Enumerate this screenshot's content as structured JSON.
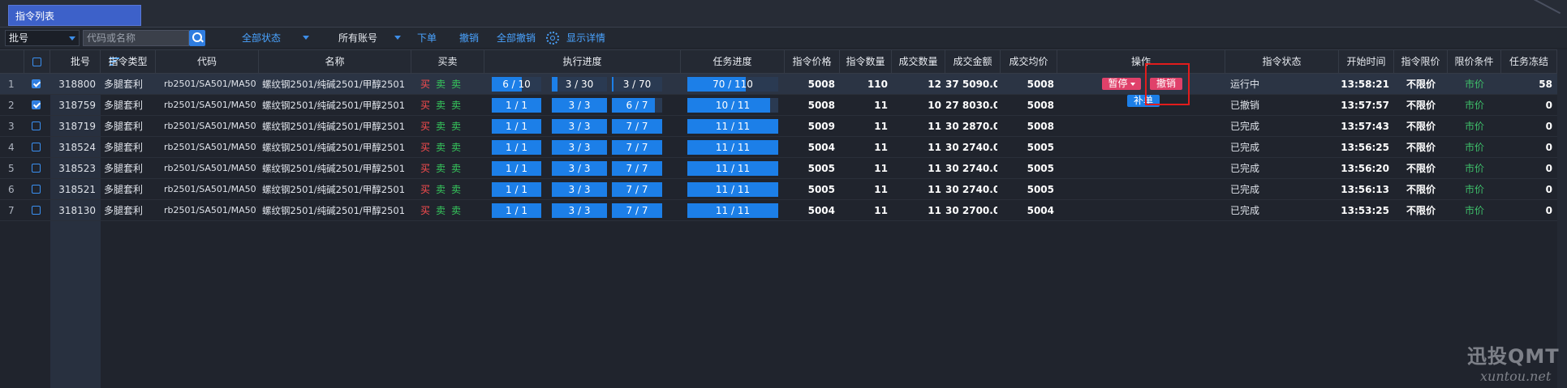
{
  "tab": {
    "label": "指令列表"
  },
  "toolbar": {
    "field_select": "批号",
    "search_placeholder": "代码或名称",
    "status_filter": "全部状态",
    "account_filter": "所有账号",
    "order_button": "下单",
    "cancel_button": "撤销",
    "cancel_all_button": "全部撤销",
    "show_details": "显示详情"
  },
  "columns": [
    "批号",
    "指令类型",
    "代码",
    "名称",
    "买卖",
    "执行进度",
    "任务进度",
    "指令价格",
    "指令数量",
    "成交数量",
    "成交金额",
    "成交均价",
    "操作",
    "指令状态",
    "开始时间",
    "指令限价",
    "限价条件",
    "任务冻结"
  ],
  "colors": {
    "accent": "#2f7de0",
    "buy": "#ff4d4f",
    "sell": "#36c95c",
    "action": "#e0416a",
    "highlight_box": "#e21c1c"
  },
  "rows": [
    {
      "idx": "1",
      "checked": true,
      "batch": "318800",
      "type": "多腿套利",
      "code": "rb2501/SA501/MA501",
      "name": "螺纹钢2501/纯碱2501/甲醇2501",
      "bs": [
        "买",
        "卖",
        "卖"
      ],
      "exec": [
        "6 / 10",
        "3 / 30",
        "3 / 70"
      ],
      "exec_frac": [
        0.6,
        0.1,
        0.04
      ],
      "task": "70 / 110",
      "task_frac": 0.64,
      "price": "5008",
      "qty": "110",
      "filled": "12",
      "amount": "37 5090.0",
      "avg": "5008",
      "ops": [
        "暂停",
        "撤销"
      ],
      "status": "运行中",
      "time": "13:58:21",
      "limit": "不限价",
      "cond": "市价",
      "frozen": "58"
    },
    {
      "idx": "2",
      "checked": true,
      "batch": "318759",
      "type": "多腿套利",
      "code": "rb2501/SA501/MA501",
      "name": "螺纹钢2501/纯碱2501/甲醇2501",
      "bs": [
        "买",
        "卖",
        "卖"
      ],
      "exec": [
        "1 / 1",
        "3 / 3",
        "6 / 7"
      ],
      "exec_frac": [
        1,
        1,
        0.857
      ],
      "task": "10 / 11",
      "task_frac": 0.909,
      "price": "5008",
      "qty": "11",
      "filled": "10",
      "amount": "27 8030.0",
      "avg": "5008",
      "ops": [
        "补单"
      ],
      "status": "已撤销",
      "time": "13:57:57",
      "limit": "不限价",
      "cond": "市价",
      "frozen": "0"
    },
    {
      "idx": "3",
      "checked": false,
      "batch": "318719",
      "type": "多腿套利",
      "code": "rb2501/SA501/MA501",
      "name": "螺纹钢2501/纯碱2501/甲醇2501",
      "bs": [
        "买",
        "卖",
        "卖"
      ],
      "exec": [
        "1 / 1",
        "3 / 3",
        "7 / 7"
      ],
      "exec_frac": [
        1,
        1,
        1
      ],
      "task": "11 / 11",
      "task_frac": 1,
      "price": "5009",
      "qty": "11",
      "filled": "11",
      "amount": "30 2870.0",
      "avg": "5008",
      "ops": [],
      "status": "已完成",
      "time": "13:57:43",
      "limit": "不限价",
      "cond": "市价",
      "frozen": "0"
    },
    {
      "idx": "4",
      "checked": false,
      "batch": "318524",
      "type": "多腿套利",
      "code": "rb2501/SA501/MA501",
      "name": "螺纹钢2501/纯碱2501/甲醇2501",
      "bs": [
        "买",
        "卖",
        "卖"
      ],
      "exec": [
        "1 / 1",
        "3 / 3",
        "7 / 7"
      ],
      "exec_frac": [
        1,
        1,
        1
      ],
      "task": "11 / 11",
      "task_frac": 1,
      "price": "5004",
      "qty": "11",
      "filled": "11",
      "amount": "30 2740.0",
      "avg": "5005",
      "ops": [],
      "status": "已完成",
      "time": "13:56:25",
      "limit": "不限价",
      "cond": "市价",
      "frozen": "0"
    },
    {
      "idx": "5",
      "checked": false,
      "batch": "318523",
      "type": "多腿套利",
      "code": "rb2501/SA501/MA501",
      "name": "螺纹钢2501/纯碱2501/甲醇2501",
      "bs": [
        "买",
        "卖",
        "卖"
      ],
      "exec": [
        "1 / 1",
        "3 / 3",
        "7 / 7"
      ],
      "exec_frac": [
        1,
        1,
        1
      ],
      "task": "11 / 11",
      "task_frac": 1,
      "price": "5005",
      "qty": "11",
      "filled": "11",
      "amount": "30 2740.0",
      "avg": "5005",
      "ops": [],
      "status": "已完成",
      "time": "13:56:20",
      "limit": "不限价",
      "cond": "市价",
      "frozen": "0"
    },
    {
      "idx": "6",
      "checked": false,
      "batch": "318521",
      "type": "多腿套利",
      "code": "rb2501/SA501/MA501",
      "name": "螺纹钢2501/纯碱2501/甲醇2501",
      "bs": [
        "买",
        "卖",
        "卖"
      ],
      "exec": [
        "1 / 1",
        "3 / 3",
        "7 / 7"
      ],
      "exec_frac": [
        1,
        1,
        1
      ],
      "task": "11 / 11",
      "task_frac": 1,
      "price": "5005",
      "qty": "11",
      "filled": "11",
      "amount": "30 2740.0",
      "avg": "5005",
      "ops": [],
      "status": "已完成",
      "time": "13:56:13",
      "limit": "不限价",
      "cond": "市价",
      "frozen": "0"
    },
    {
      "idx": "7",
      "checked": false,
      "batch": "318130",
      "type": "多腿套利",
      "code": "rb2501/SA501/MA501",
      "name": "螺纹钢2501/纯碱2501/甲醇2501",
      "bs": [
        "买",
        "卖",
        "卖"
      ],
      "exec": [
        "1 / 1",
        "3 / 3",
        "7 / 7"
      ],
      "exec_frac": [
        1,
        1,
        1
      ],
      "task": "11 / 11",
      "task_frac": 1,
      "price": "5004",
      "qty": "11",
      "filled": "11",
      "amount": "30 2700.0",
      "avg": "5004",
      "ops": [],
      "status": "已完成",
      "time": "13:53:25",
      "limit": "不限价",
      "cond": "市价",
      "frozen": "0"
    }
  ],
  "watermark": {
    "brand": "迅投QMT",
    "url": "xuntou.net"
  }
}
